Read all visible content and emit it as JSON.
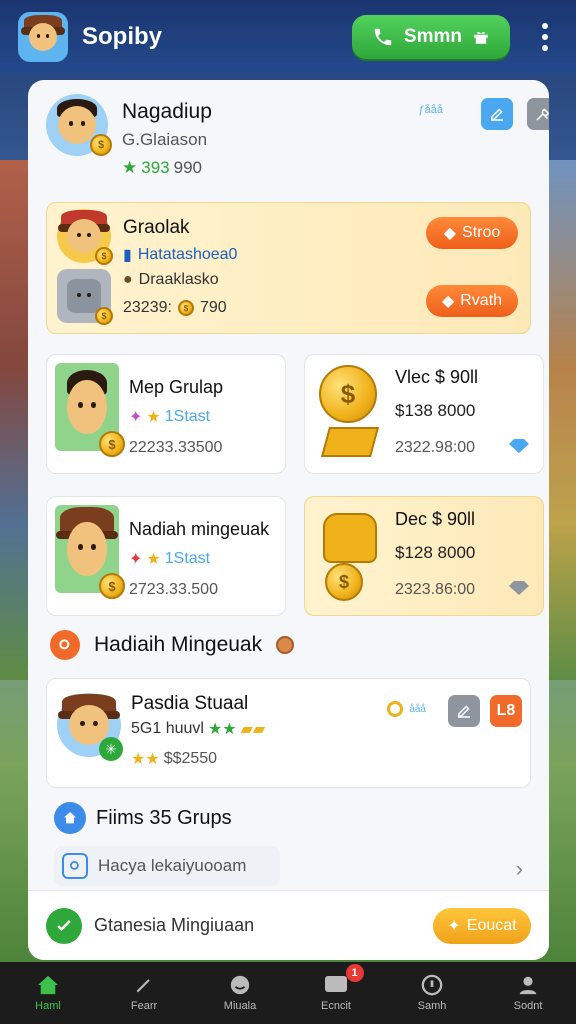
{
  "topbar": {
    "app_title": "Sopiby",
    "cta_label": "Smmn",
    "colors": {
      "bar": "#1b3570",
      "cta": "#2ea83a"
    }
  },
  "profile": {
    "name": "Nagadiup",
    "subtitle": "G.Glaiason",
    "stat_green": "393",
    "stat_rest": "990",
    "small_label": "ƒååå"
  },
  "friend_card": {
    "title": "Graolak",
    "line_blue": "Hatatashoea0",
    "line_dark": "Draaklasko",
    "line_amount_a": "23239:",
    "line_amount_b": "790",
    "btn_top": "Stroo",
    "btn_bottom": "Rvath"
  },
  "cards": [
    {
      "title": "Mep Grulap",
      "tag": "1Stast",
      "amount": "22233.33500"
    },
    {
      "title": "Vlec $ 90ll",
      "price": "$138 8000",
      "amount": "2322.98:00"
    },
    {
      "title": "Nadiah mingeuak",
      "tag": "1Stast",
      "amount": "2723.33.500"
    },
    {
      "title": "Dec $ 90ll",
      "price": "$128 8000",
      "amount": "2323.86:00"
    }
  ],
  "section": {
    "title": "Hadiaih Mingeuak"
  },
  "activity": {
    "name": "Pasdia Stuaal",
    "line2": "5G1 huuvl",
    "amount": "$$2550",
    "small": "ååå",
    "btn_label": "L8"
  },
  "groups": {
    "title": "Fiims 35 Grups"
  },
  "search": {
    "placeholder": "Hacya lekaiyuooam"
  },
  "bottom_card": {
    "label": "Gtanesia Mingiuaan",
    "btn_label": "Eoucat"
  },
  "nav": [
    {
      "label": "Haml",
      "icon": "home-icon"
    },
    {
      "label": "Fearr",
      "icon": "pen-icon"
    },
    {
      "label": "Miuala",
      "icon": "smile-icon"
    },
    {
      "label": "Ecncit",
      "icon": "chat-icon",
      "badge": "1"
    },
    {
      "label": "Samh",
      "icon": "info-icon"
    },
    {
      "label": "Sodnt",
      "icon": "profile-icon"
    }
  ]
}
